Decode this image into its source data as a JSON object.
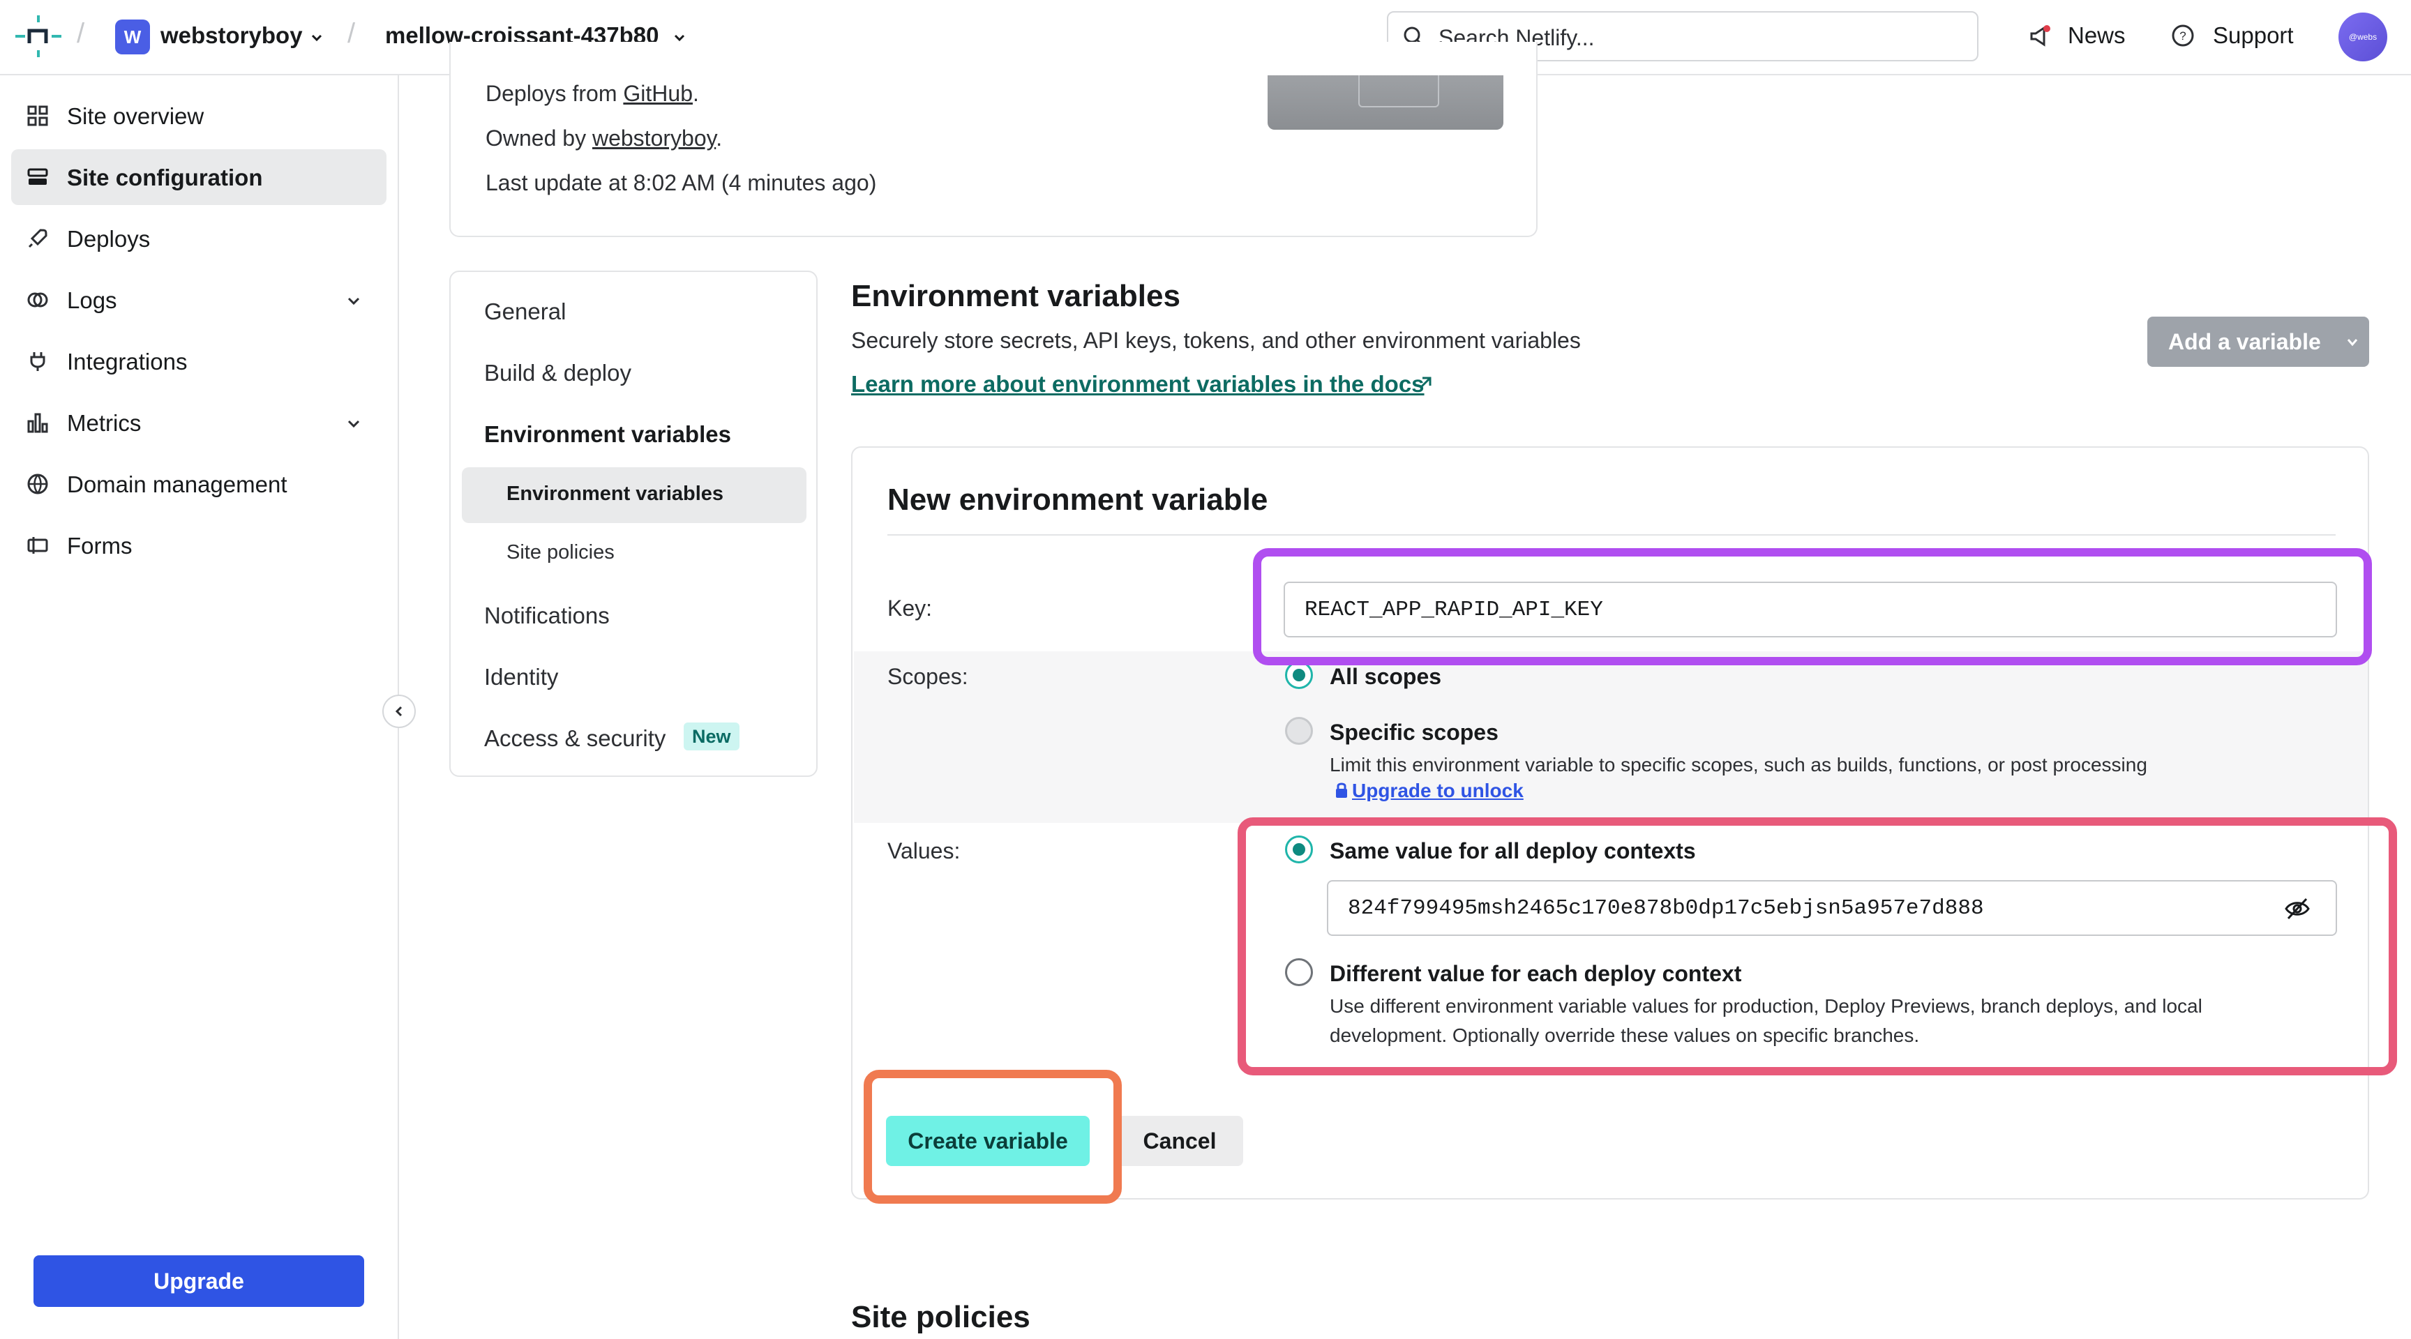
{
  "topbar": {
    "team_initial": "W",
    "team_name": "webstoryboy",
    "site_name": "mellow-croissant-437b80",
    "search_placeholder": "Search Netlify...",
    "news_label": "News",
    "support_label": "Support",
    "avatar_text": "@webs"
  },
  "sidebar": {
    "items": [
      {
        "label": "Site overview",
        "icon": "grid-icon"
      },
      {
        "label": "Site configuration",
        "icon": "config-icon",
        "active": true
      },
      {
        "label": "Deploys",
        "icon": "rocket-icon"
      },
      {
        "label": "Logs",
        "icon": "logs-icon",
        "expandable": true
      },
      {
        "label": "Integrations",
        "icon": "plug-icon"
      },
      {
        "label": "Metrics",
        "icon": "bar-chart-icon",
        "expandable": true
      },
      {
        "label": "Domain management",
        "icon": "globe-icon"
      },
      {
        "label": "Forms",
        "icon": "form-icon"
      }
    ],
    "upgrade_label": "Upgrade"
  },
  "site_card": {
    "deploys_prefix": "Deploys from ",
    "deploys_link": "GitHub",
    "deploys_suffix": ".",
    "owned_prefix": "Owned by ",
    "owned_link": "webstoryboy",
    "owned_suffix": ".",
    "last_update": "Last update at 8:02 AM (4 minutes ago)"
  },
  "subnav": {
    "items": [
      "General",
      "Build & deploy",
      "Environment variables",
      "Notifications",
      "Identity",
      "Access & security"
    ],
    "sub_items": [
      "Environment variables",
      "Site policies"
    ],
    "new_badge": "New"
  },
  "env_section": {
    "title": "Environment variables",
    "description": "Securely store secrets, API keys, tokens, and other environment variables",
    "docs_link": "Learn more about environment variables in the docs",
    "add_button": "Add a variable"
  },
  "form": {
    "title": "New environment variable",
    "key_label": "Key:",
    "key_value": "REACT_APP_RAPID_API_KEY",
    "scopes_label": "Scopes:",
    "all_scopes": "All scopes",
    "specific_scopes": "Specific scopes",
    "specific_desc": "Limit this environment variable to specific scopes, such as builds, functions, or post processing",
    "upgrade_unlock": "Upgrade to unlock",
    "values_label": "Values:",
    "same_value": "Same value for all deploy contexts",
    "value": "824f799495msh2465c170e878b0dp17c5ebjsn5a957e7d888",
    "different_value": "Different value for each deploy context",
    "different_desc_1": "Use different environment variable values for production, Deploy Previews, branch deploys, and local",
    "different_desc_2": "development. Optionally override these values on specific branches.",
    "create_button": "Create variable",
    "cancel_button": "Cancel"
  },
  "site_policies_title": "Site policies",
  "colors": {
    "accent_teal": "#6ff1e5",
    "brand_blue": "#2f54e4",
    "link_teal": "#0d6b62"
  }
}
